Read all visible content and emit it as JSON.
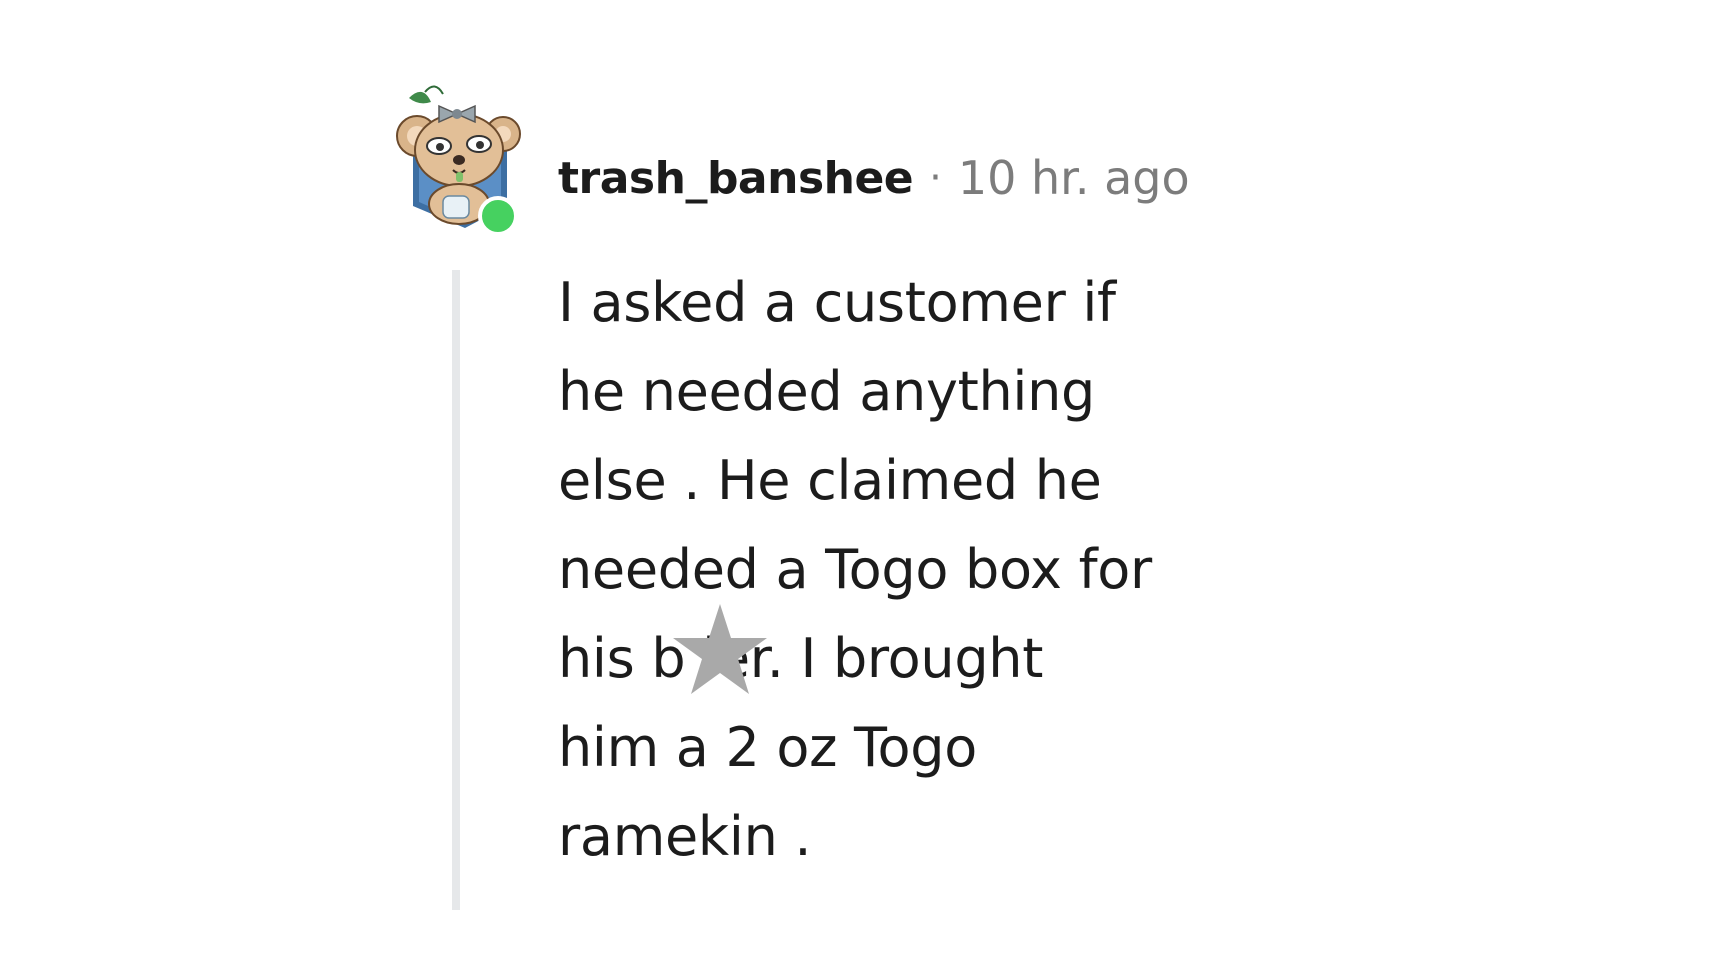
{
  "comment": {
    "username": "trash_banshee",
    "separator": "·",
    "timestamp": "10 hr. ago",
    "body_lines": [
      "I asked a customer if",
      "he needed anything",
      "else . He claimed he",
      "needed a Togo box for",
      "his b   ier. I brought",
      "him a 2 oz Togo",
      "ramekin ."
    ],
    "online_status_color": "#46d160"
  },
  "icons": {
    "avatar": "koala-avatar-icon",
    "overlay": "star-icon"
  }
}
